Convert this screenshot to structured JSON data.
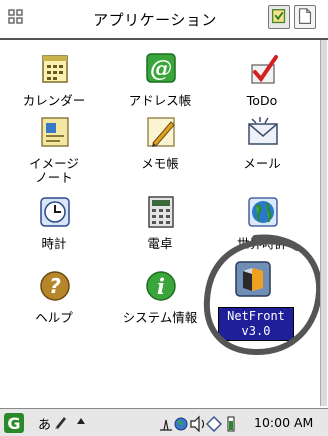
{
  "title": "アプリケーション",
  "apps": [
    {
      "label": "カレンダー",
      "icon": "calendar-icon"
    },
    {
      "label": "アドレス帳",
      "icon": "address-book-icon"
    },
    {
      "label": "ToDo",
      "icon": "todo-icon"
    },
    {
      "label": "イメージ",
      "label2": "ノート",
      "icon": "image-note-icon"
    },
    {
      "label": "メモ帳",
      "icon": "memo-icon"
    },
    {
      "label": "メール",
      "icon": "mail-icon"
    },
    {
      "label": "時計",
      "icon": "clock-icon"
    },
    {
      "label": "電卓",
      "icon": "calculator-icon"
    },
    {
      "label": "世界時計",
      "icon": "world-clock-icon"
    },
    {
      "label": "ヘルプ",
      "icon": "help-icon"
    },
    {
      "label": "システム情報",
      "icon": "system-info-icon"
    },
    {
      "label": "NetFront v3.0",
      "line1": "NetFront",
      "line2": "v3.0",
      "icon": "netfront-icon"
    }
  ],
  "taskbar": {
    "ime": "あ",
    "clock": "10:00 AM"
  },
  "colors": {
    "netfront_label_bg": "#1f1f9a",
    "annotation": "#555555"
  }
}
